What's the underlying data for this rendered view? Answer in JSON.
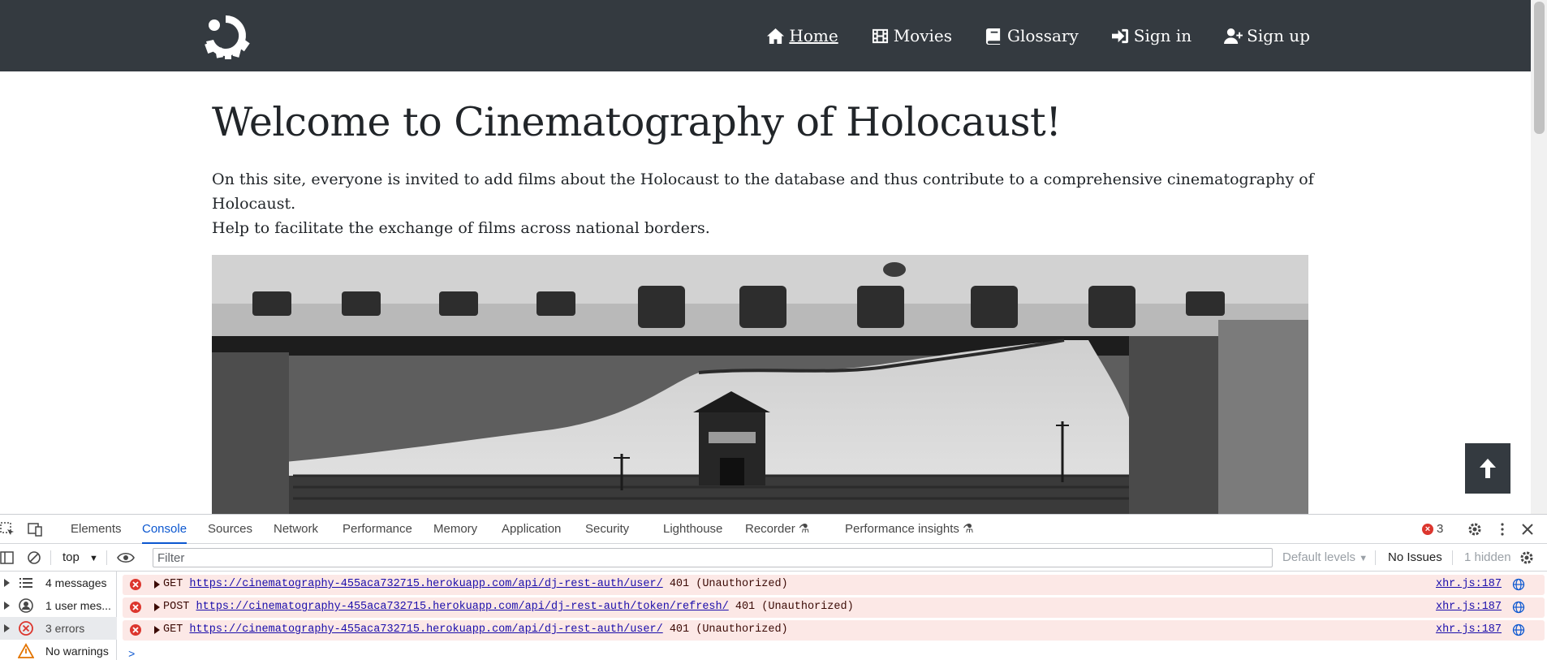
{
  "navbar": {
    "items": [
      {
        "label": "Home",
        "icon": "house-icon"
      },
      {
        "label": "Movies",
        "icon": "film-icon"
      },
      {
        "label": "Glossary",
        "icon": "book-icon"
      },
      {
        "label": "Sign in",
        "icon": "sign-in-icon"
      },
      {
        "label": "Sign up",
        "icon": "user-plus-icon"
      }
    ]
  },
  "main": {
    "title": "Welcome to Cinematography of Holocaust!",
    "intro_line1": "On this site, everyone is invited to add films about the Holocaust to the database and thus contribute to a comprehensive cinematography of Holocaust.",
    "intro_line2": "Help to facilitate the exchange of films across national borders."
  },
  "devtools": {
    "tabs": [
      "Elements",
      "Console",
      "Sources",
      "Network",
      "Performance",
      "Memory",
      "Application",
      "Security",
      "Lighthouse",
      "Recorder",
      "Performance insights"
    ],
    "active_tab": "Console",
    "error_count": "3",
    "toolbar": {
      "context": "top",
      "filter_placeholder": "Filter",
      "levels": "Default levels",
      "issues": "No Issues",
      "hidden": "1 hidden"
    },
    "sidebar": [
      {
        "label": "4 messages",
        "icon": "list-icon"
      },
      {
        "label": "1 user mes...",
        "icon": "user-icon"
      },
      {
        "label": "3 errors",
        "icon": "error-icon"
      },
      {
        "label": "No warnings",
        "icon": "warning-icon"
      }
    ],
    "logs": [
      {
        "method": "GET",
        "url": "https://cinematography-455aca732715.herokuapp.com/api/dj-rest-auth/user/",
        "status": "401 (Unauthorized)",
        "source": "xhr.js:187"
      },
      {
        "method": "POST",
        "url": "https://cinematography-455aca732715.herokuapp.com/api/dj-rest-auth/token/refresh/",
        "status": "401 (Unauthorized)",
        "source": "xhr.js:187"
      },
      {
        "method": "GET",
        "url": "https://cinematography-455aca732715.herokuapp.com/api/dj-rest-auth/user/",
        "status": "401 (Unauthorized)",
        "source": "xhr.js:187"
      }
    ],
    "prompt_symbol": ">"
  },
  "colors": {
    "navbar_bg": "#343a40",
    "accent": "#0b57d0",
    "error_bg": "#fce8e6",
    "error_red": "#dc362e"
  }
}
